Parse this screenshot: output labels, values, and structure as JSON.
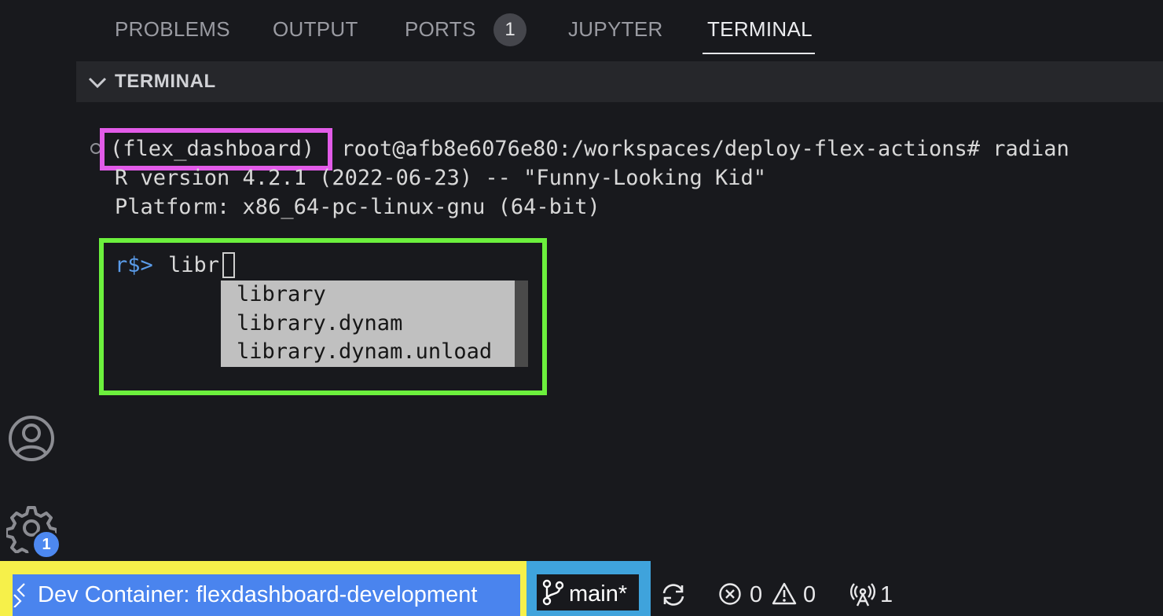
{
  "panel": {
    "tabs": [
      {
        "label": "PROBLEMS",
        "active": false
      },
      {
        "label": "OUTPUT",
        "active": false
      },
      {
        "label": "PORTS",
        "active": false,
        "badge": "1"
      },
      {
        "label": "JUPYTER",
        "active": false
      },
      {
        "label": "TERMINAL",
        "active": true
      }
    ],
    "section_title": "TERMINAL"
  },
  "terminal": {
    "env_name": "(flex_dashboard)",
    "command_line": " root@afb8e6076e80:/workspaces/deploy-flex-actions# radian",
    "version_line": "R version 4.2.1 (2022-06-23) -- \"Funny-Looking Kid\"",
    "platform_line": "Platform: x86_64-pc-linux-gnu (64-bit)",
    "r_prompt": "r$>",
    "input_text": "libr",
    "completions": [
      "library",
      "library.dynam",
      "library.dynam.unload"
    ]
  },
  "activity_bar": {
    "settings_badge": "1",
    "icons": [
      "account-icon",
      "gear-icon"
    ]
  },
  "statusbar": {
    "remote_label": "Dev Container: flexdashboard-development",
    "branch_label": "main*",
    "errors": "0",
    "warnings": "0",
    "ports_forwarded": "1"
  },
  "colors": {
    "background": "#18191d",
    "highlight_magenta": "#e25be8",
    "highlight_green": "#6cf03d",
    "highlight_yellow": "#f6f04a",
    "highlight_blue": "#3fa3dc",
    "remote_button": "#4a84ee",
    "r_prompt": "#5a9be8"
  }
}
